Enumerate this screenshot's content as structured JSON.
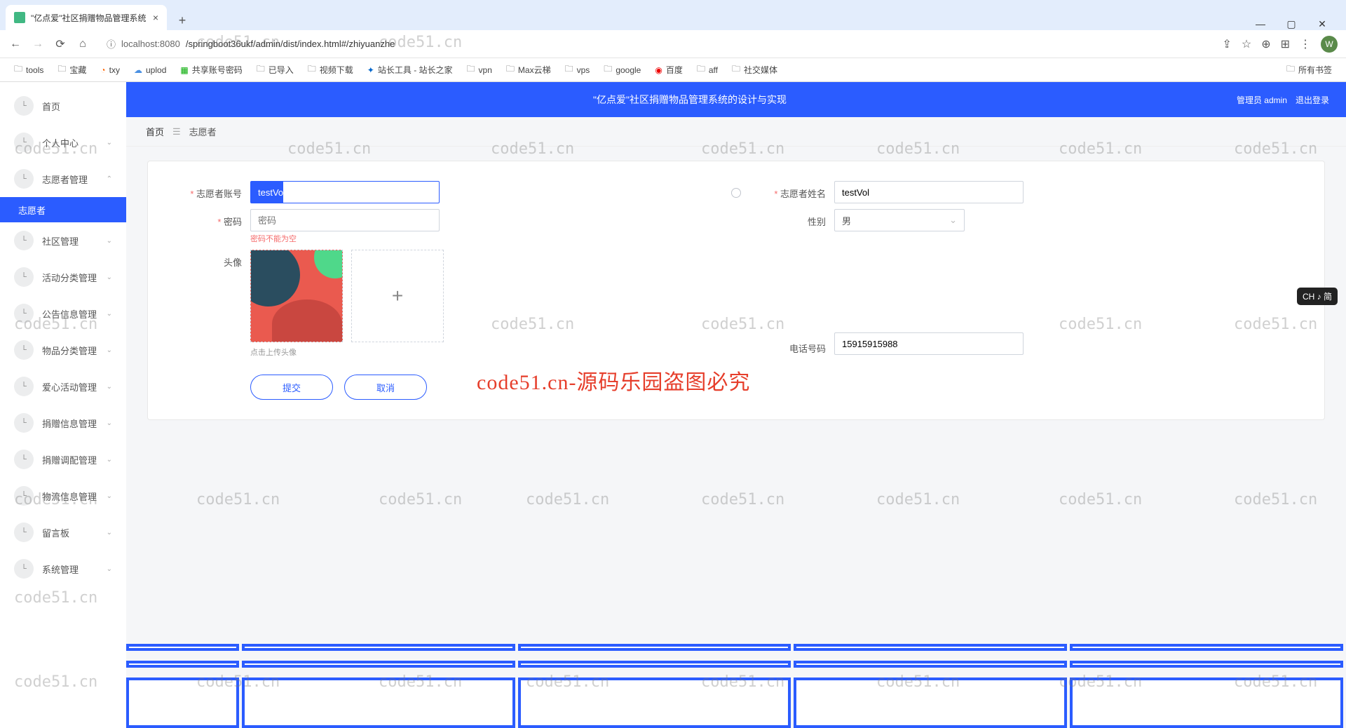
{
  "browser": {
    "tab_title": "\"亿点爱\"社区捐赠物品管理系统",
    "url_host": "localhost:8080",
    "url_path": "/springboot36ukf/admin/dist/index.html#/zhiyuanzhe",
    "avatar_letter": "W"
  },
  "bookmarks": [
    "tools",
    "宝藏",
    "txy",
    "uplod",
    "共享账号密码",
    "已导入",
    "视频下载",
    "站长工具 - 站长之家",
    "vpn",
    "Max云梯",
    "vps",
    "google",
    "百度",
    "aff",
    "社交媒体"
  ],
  "bookmarks_right": "所有书签",
  "topbar": {
    "title": "\"亿点爱\"社区捐赠物品管理系统的设计与实现",
    "user": "管理员 admin",
    "logout": "退出登录"
  },
  "sidebar": {
    "home": "首页",
    "items": [
      "个人中心",
      "志愿者管理",
      "社区管理",
      "活动分类管理",
      "公告信息管理",
      "物品分类管理",
      "爱心活动管理",
      "捐赠信息管理",
      "捐赠调配管理",
      "物流信息管理",
      "留言板",
      "系统管理"
    ],
    "sub_active": "志愿者"
  },
  "breadcrumb": {
    "home": "首页",
    "current": "志愿者"
  },
  "form": {
    "account_label": "志愿者账号",
    "account_value": "testVol",
    "name_label": "志愿者姓名",
    "name_value": "testVol",
    "password_label": "密码",
    "password_placeholder": "密码",
    "password_error": "密码不能为空",
    "gender_label": "性别",
    "gender_value": "男",
    "avatar_label": "头像",
    "avatar_hint": "点击上传头像",
    "phone_label": "电话号码",
    "phone_value": "15915915988",
    "submit": "提交",
    "cancel": "取消"
  },
  "ime": "CH ♪ 简",
  "watermark": "code51.cn",
  "watermark_red": "code51.cn-源码乐园盗图必究"
}
